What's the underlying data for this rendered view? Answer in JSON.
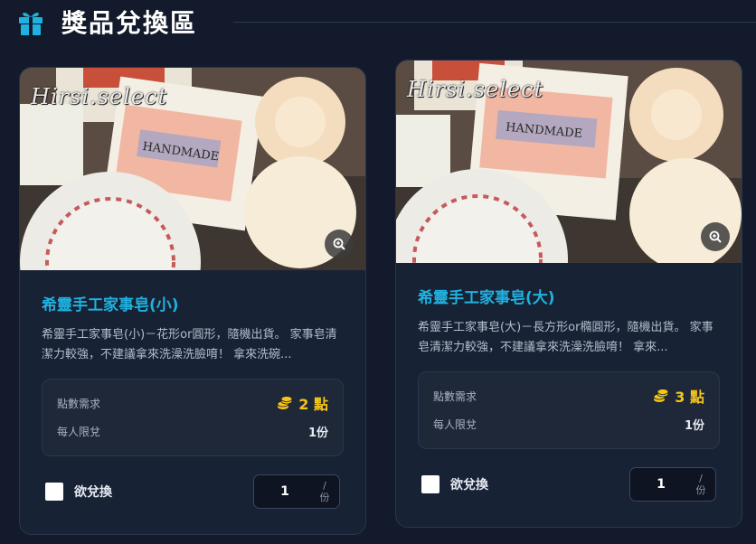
{
  "header": {
    "title": "獎品兌換區",
    "icon": "gift-icon",
    "accent": "#1fb2e0"
  },
  "colors": {
    "background": "#121a2b",
    "card": "#182235",
    "name": "#1fb2e0",
    "points": "#f5c518"
  },
  "cards": [
    {
      "watermark": "Hirsi.select",
      "name": "希靈手工家事皂(小)",
      "description": "希靈手工家事皂(小)－花形or圓形，隨機出貨。 家事皂清潔力較強，不建議拿來洗澡洗臉唷！ 拿來洗碗...",
      "points_label": "點數需求",
      "points_value": "2 點",
      "limit_label": "每人限兌",
      "limit_value": "1份",
      "checkbox_label": "欲兌換",
      "quantity": "1",
      "unit_slash": "/",
      "unit": "份"
    },
    {
      "watermark": "Hirsi.select",
      "name": "希靈手工家事皂(大)",
      "description": "希靈手工家事皂(大)－長方形or橢圓形，隨機出貨。 家事皂清潔力較強，不建議拿來洗澡洗臉唷！ 拿來...",
      "points_label": "點數需求",
      "points_value": "3 點",
      "limit_label": "每人限兌",
      "limit_value": "1份",
      "checkbox_label": "欲兌換",
      "quantity": "1",
      "unit_slash": "/",
      "unit": "份"
    }
  ]
}
